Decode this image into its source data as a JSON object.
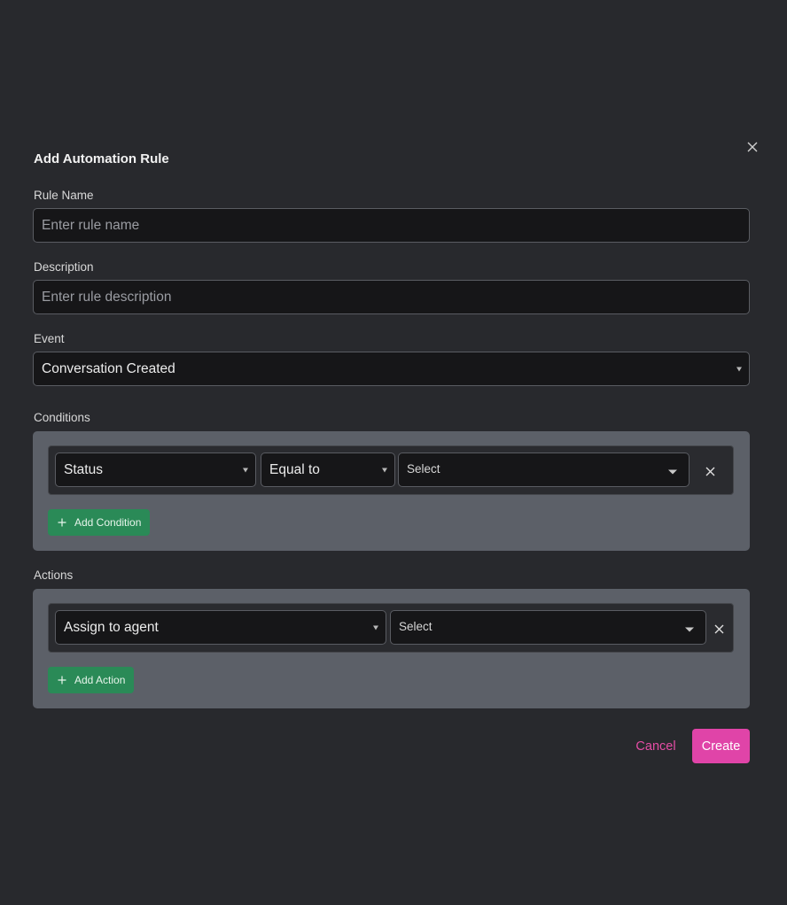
{
  "modal": {
    "title": "Add Automation Rule",
    "close_icon": "close-icon"
  },
  "rule_name": {
    "label": "Rule Name",
    "value": "",
    "placeholder": "Enter rule name"
  },
  "description": {
    "label": "Description",
    "value": "",
    "placeholder": "Enter rule description"
  },
  "event": {
    "label": "Event",
    "selected": "Conversation Created"
  },
  "conditions": {
    "label": "Conditions",
    "rows": [
      {
        "attribute": "Status",
        "operator": "Equal to",
        "value": "Select"
      }
    ],
    "add_label": "Add Condition"
  },
  "actions": {
    "label": "Actions",
    "rows": [
      {
        "action": "Assign to agent",
        "value": "Select"
      }
    ],
    "add_label": "Add Action"
  },
  "footer": {
    "cancel_label": "Cancel",
    "create_label": "Create"
  },
  "colors": {
    "background": "#28292d",
    "input_bg": "#161618",
    "panel_bg": "#5c6068",
    "add_button": "#2a8a57",
    "primary": "#e044a8"
  }
}
